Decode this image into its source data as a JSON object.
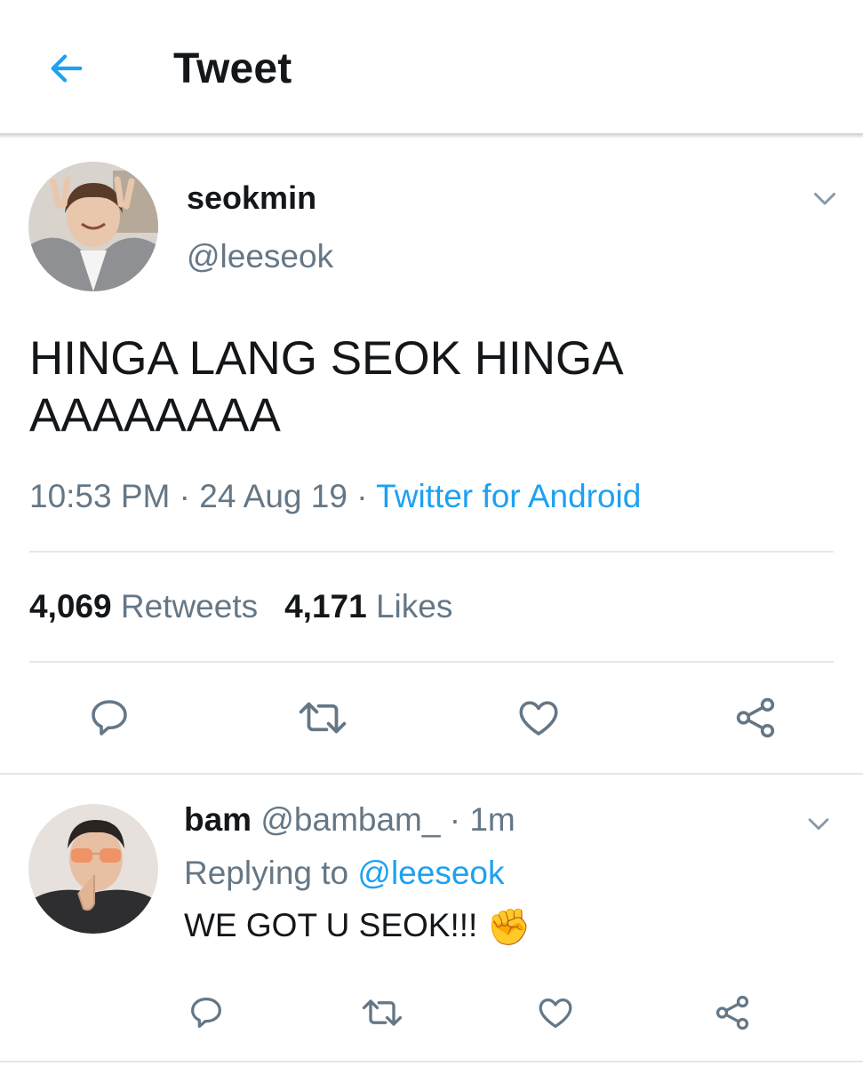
{
  "header": {
    "back_icon": "arrow-left-icon",
    "title": "Tweet",
    "accent": "#1da1f2"
  },
  "tweet": {
    "author_name": "seokmin",
    "author_handle": "@leeseok",
    "text_line1": "HINGA LANG SEOK HINGA",
    "text_line2": "AAAAAAAA",
    "time": "10:53 PM",
    "date": "24 Aug 19",
    "separator": "·",
    "source": "Twitter for Android",
    "retweet_count": "4,069",
    "retweet_label": "Retweets",
    "like_count": "4,171",
    "like_label": "Likes",
    "actions": [
      "reply-icon",
      "retweet-icon",
      "like-icon",
      "share-icon"
    ]
  },
  "reply": {
    "author_name": "bam",
    "author_handle": "@bambam_",
    "time": "1m",
    "separator": "·",
    "replying_prefix": "Replying to",
    "replying_handle": "@leeseok",
    "text": "WE GOT U SEOK!!!",
    "emoji": "✊",
    "actions": [
      "reply-icon",
      "retweet-icon",
      "like-icon",
      "share-icon"
    ]
  },
  "colors": {
    "text": "#14171a",
    "secondary": "#657786",
    "link": "#1da1f2",
    "divider": "#e1e8ed"
  }
}
